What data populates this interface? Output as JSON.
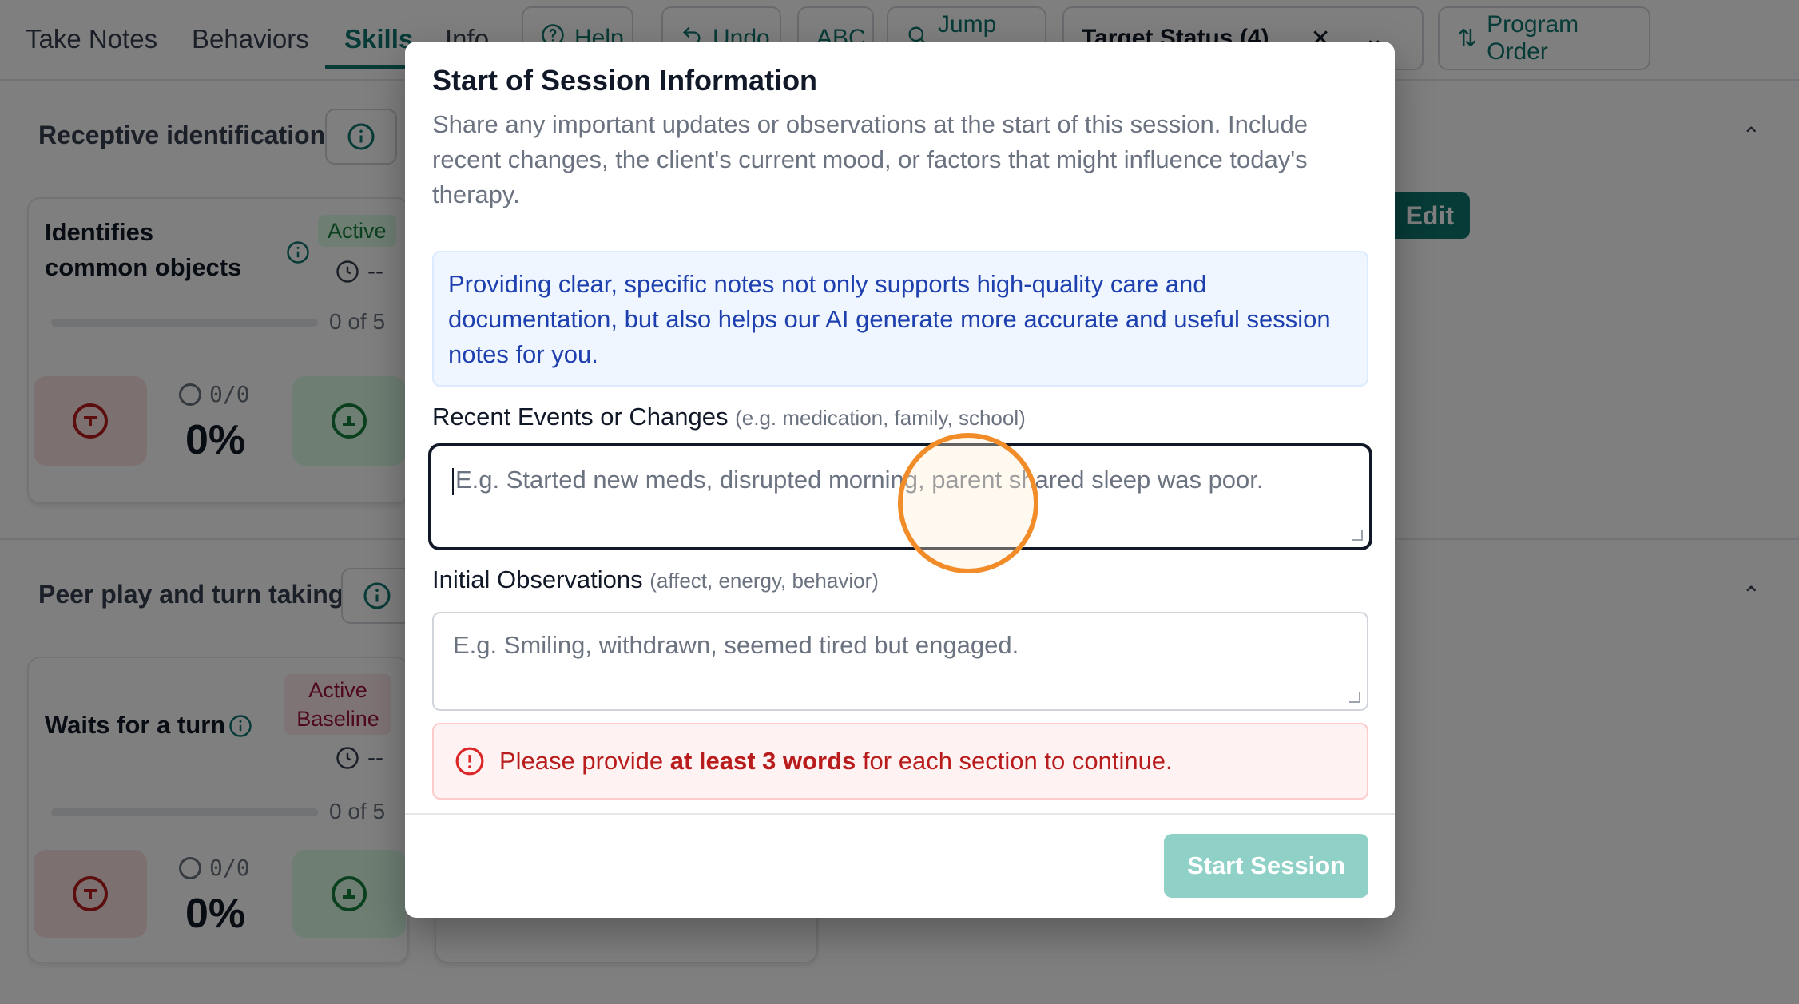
{
  "nav": {
    "tabs": [
      "Take Notes",
      "Behaviors",
      "Skills",
      "Info"
    ],
    "help_label": "Help",
    "undo_label": "Undo",
    "abc_label": "ABC",
    "jump_label": "Jump To",
    "target_status_label": "Target Status (4)",
    "program_order_label": "Program Order"
  },
  "sections": [
    {
      "title": "Receptive identification",
      "edit_label": "Edit",
      "card": {
        "title_line1": "Identifies",
        "title_line2": "common objects",
        "status": "Active",
        "duration": "--",
        "progress_text": "0 of 5",
        "count": "0/0",
        "percent": "0%"
      }
    },
    {
      "title": "Peer play and turn taking",
      "card": {
        "title": "Waits for a turn",
        "status_line1": "Active",
        "status_line2": "Baseline",
        "duration": "--",
        "progress_text": "0 of 5",
        "count": "0/0",
        "percent": "0%"
      }
    }
  ],
  "modal": {
    "title": "Start of Session Information",
    "description": "Share any important updates or observations at the start of this session. Include recent changes, the client's current mood, or factors that might influence today's therapy.",
    "note": "Providing clear, specific notes not only supports high-quality care and documentation, but also helps our AI generate more accurate and useful session notes for you.",
    "recent_events": {
      "label": "Recent Events or Changes",
      "hint": "(e.g. medication, family, school)",
      "placeholder": "E.g. Started new meds, disrupted morning, parent shared sleep was poor.",
      "value": ""
    },
    "initial_observations": {
      "label": "Initial Observations",
      "hint": "(affect, energy, behavior)",
      "placeholder": "E.g. Smiling, withdrawn, seemed tired but engaged.",
      "value": ""
    },
    "error": {
      "prefix": "Please provide",
      "emphasis": "at least 3 words",
      "suffix": "for each section to continue."
    },
    "start_button": "Start Session"
  },
  "colors": {
    "brand": "#0f766e",
    "start_button_disabled": "#8fd1c7",
    "error_text": "#b91c1c",
    "note_text": "#1e40af",
    "click_indicator": "#f28c28"
  }
}
